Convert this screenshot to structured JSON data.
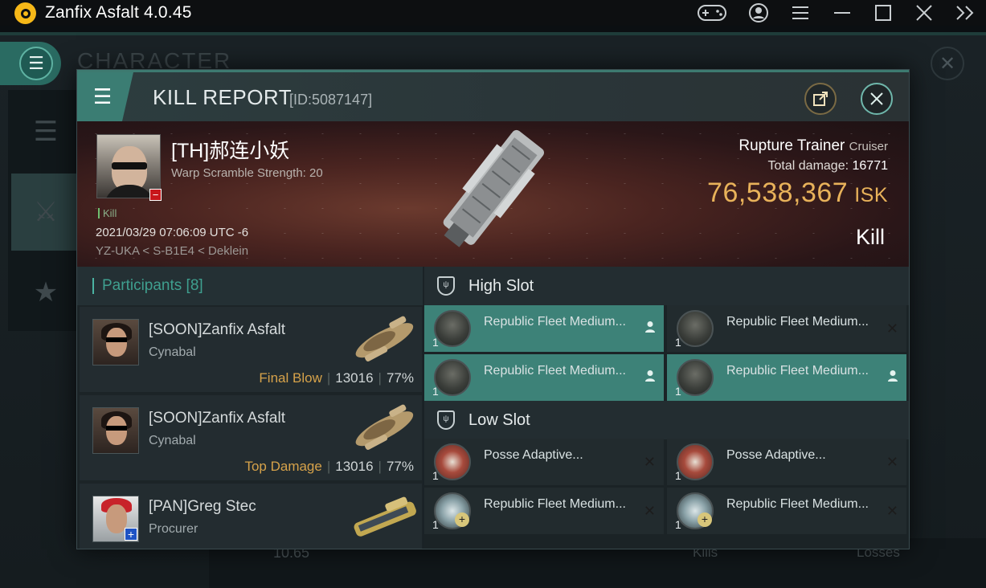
{
  "app": {
    "title": "Zanfix Asfalt 4.0.45"
  },
  "background": {
    "page_title": "CHARACTER",
    "bottom_value": "10.65",
    "kills_label": "Kills",
    "losses_label": "Losses"
  },
  "kill_report": {
    "title": "KILL REPORT",
    "id": "[ID:5087147]",
    "victim": {
      "name": "[TH]郝连小妖",
      "warp": "Warp Scramble Strength: 20",
      "kill_tag": "Kill",
      "datetime": "2021/03/29 07:06:09 UTC -6",
      "location": "YZ-UKA < S-B1E4 < Deklein"
    },
    "ship": {
      "name": "Rupture Trainer",
      "class": "Cruiser",
      "total_damage_label": "Total damage:",
      "total_damage": "16771",
      "isk_value": "76,538,367",
      "isk_unit": "ISK",
      "result": "Kill"
    },
    "participants": {
      "title": "Participants [8]",
      "rows": [
        {
          "name": "[SOON]Zanfix Asfalt",
          "ship": "Cynabal",
          "tag": "Final Blow",
          "damage": "13016",
          "percent": "77%"
        },
        {
          "name": "[SOON]Zanfix Asfalt",
          "ship": "Cynabal",
          "tag": "Top Damage",
          "damage": "13016",
          "percent": "77%"
        },
        {
          "name": "[PAN]Greg Stec",
          "ship": "Procurer",
          "tag": "",
          "damage": "",
          "percent": ""
        }
      ]
    },
    "slots": {
      "high_title": "High Slot",
      "high_items": [
        {
          "name": "Republic Fleet Medium...",
          "qty": "1",
          "state": "user-icon",
          "highlighted": true
        },
        {
          "name": "Republic Fleet Medium...",
          "qty": "1",
          "state": "x-icon",
          "highlighted": false
        },
        {
          "name": "Republic Fleet Medium...",
          "qty": "1",
          "state": "user-icon",
          "highlighted": true
        },
        {
          "name": "Republic Fleet Medium...",
          "qty": "1",
          "state": "user-icon",
          "highlighted": true
        }
      ],
      "low_title": "Low Slot",
      "low_items": [
        {
          "name": "Posse Adaptive...",
          "qty": "1",
          "state": "x-icon"
        },
        {
          "name": "Posse Adaptive...",
          "qty": "1",
          "state": "x-icon"
        },
        {
          "name": "Republic Fleet Medium...",
          "qty": "1",
          "state": "x-icon"
        },
        {
          "name": "Republic Fleet Medium...",
          "qty": "1",
          "state": "x-icon"
        }
      ]
    }
  },
  "colors": {
    "accent": "#3d8278",
    "isk": "#e8b25a",
    "tag": "#d6a24a",
    "participants_title": "#3f9f8f"
  }
}
